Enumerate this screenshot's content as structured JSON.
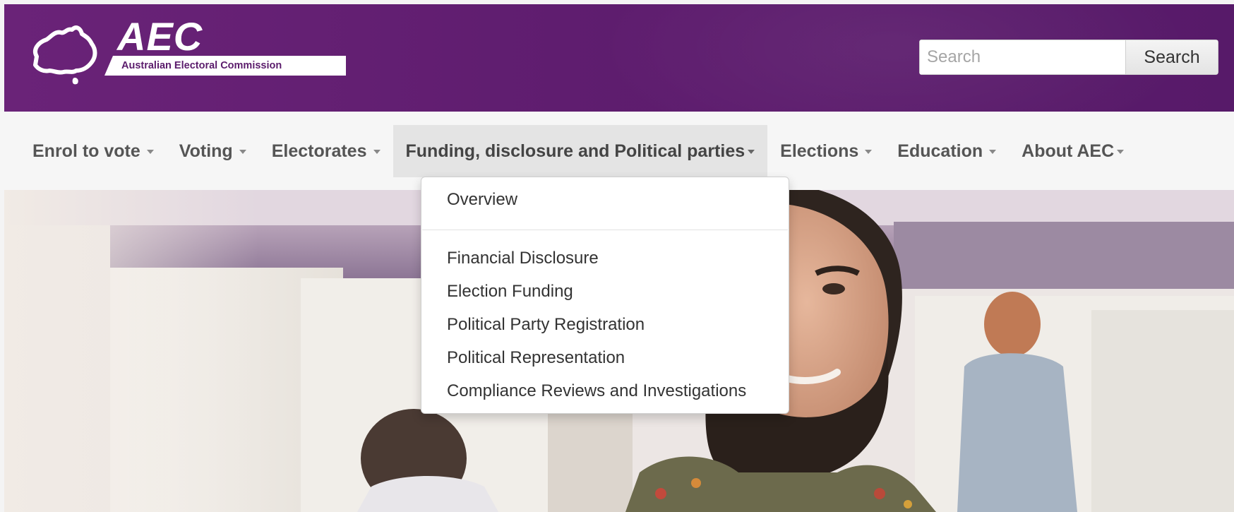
{
  "header": {
    "logo_acronym": "AEC",
    "logo_name": "Australian Electoral Commission",
    "search": {
      "placeholder": "Search",
      "value": "",
      "button_label": "Search"
    }
  },
  "nav": {
    "items": [
      {
        "label": "Enrol to vote"
      },
      {
        "label": "Voting"
      },
      {
        "label": "Electorates"
      },
      {
        "label": "Funding, disclosure and Political parties"
      },
      {
        "label": "Elections"
      },
      {
        "label": "Education"
      },
      {
        "label": "About AEC"
      }
    ],
    "active_index": 3
  },
  "dropdown": {
    "items": [
      {
        "label": "Overview"
      },
      {
        "label": "Financial Disclosure"
      },
      {
        "label": "Election Funding"
      },
      {
        "label": "Political Party Registration"
      },
      {
        "label": "Political Representation"
      },
      {
        "label": "Compliance Reviews and Investigations"
      }
    ]
  },
  "colors": {
    "header_purple": "#5f1d6f",
    "nav_bg": "#f6f6f6",
    "nav_active_bg": "#e4e4e4",
    "nav_text": "#555555"
  },
  "icons": {
    "logo_map": "australia-map-icon",
    "caret": "caret-down-icon"
  }
}
